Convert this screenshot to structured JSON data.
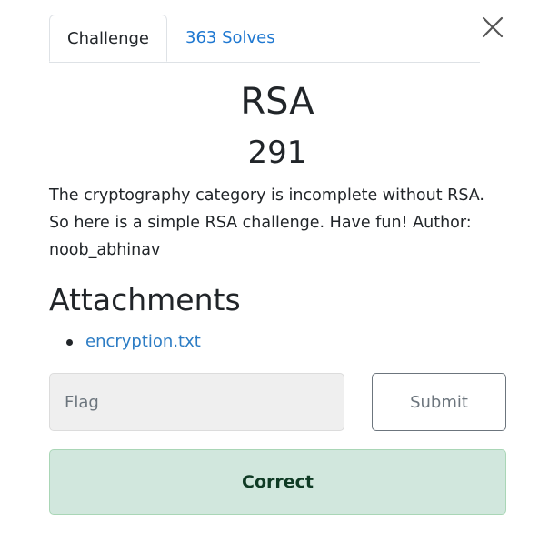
{
  "tabs": [
    {
      "label": "Challenge",
      "active": true
    },
    {
      "label": "363 Solves",
      "active": false
    }
  ],
  "close_icon": "close-icon",
  "challenge": {
    "name": "RSA",
    "points": "291",
    "description": "The cryptography category is incomplete without RSA. So here is a simple RSA challenge. Have fun! Author: noob_abhinav"
  },
  "attachments": {
    "heading": "Attachments",
    "files": [
      "encryption.txt"
    ]
  },
  "flag_form": {
    "placeholder": "Flag",
    "value": "",
    "submit_label": "Submit"
  },
  "result": {
    "message": "Correct",
    "status": "success"
  },
  "colors": {
    "link": "#2c7cc4",
    "success_bg": "#d1e7dd",
    "success_text": "#0f3b24"
  }
}
